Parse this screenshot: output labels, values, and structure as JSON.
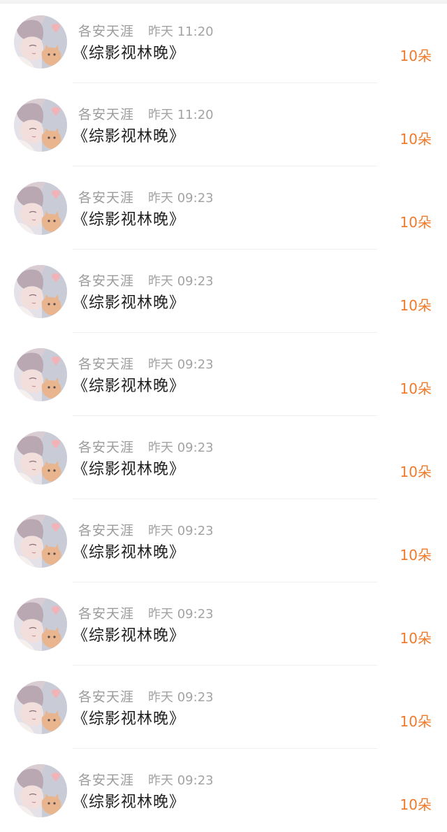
{
  "colors": {
    "amount": "#f07a2a",
    "name": "#9b9b9b",
    "title": "#1f1f1f"
  },
  "items": [
    {
      "user": "各安天涯",
      "time": "昨天 11:20",
      "book": "《综影视林晚》",
      "amount": "10朵",
      "avatar_icon": "avatar-girl-with-cat"
    },
    {
      "user": "各安天涯",
      "time": "昨天 11:20",
      "book": "《综影视林晚》",
      "amount": "10朵",
      "avatar_icon": "avatar-girl-with-cat"
    },
    {
      "user": "各安天涯",
      "time": "昨天 09:23",
      "book": "《综影视林晚》",
      "amount": "10朵",
      "avatar_icon": "avatar-girl-with-cat"
    },
    {
      "user": "各安天涯",
      "time": "昨天 09:23",
      "book": "《综影视林晚》",
      "amount": "10朵",
      "avatar_icon": "avatar-girl-with-cat"
    },
    {
      "user": "各安天涯",
      "time": "昨天 09:23",
      "book": "《综影视林晚》",
      "amount": "10朵",
      "avatar_icon": "avatar-girl-with-cat"
    },
    {
      "user": "各安天涯",
      "time": "昨天 09:23",
      "book": "《综影视林晚》",
      "amount": "10朵",
      "avatar_icon": "avatar-girl-with-cat"
    },
    {
      "user": "各安天涯",
      "time": "昨天 09:23",
      "book": "《综影视林晚》",
      "amount": "10朵",
      "avatar_icon": "avatar-girl-with-cat"
    },
    {
      "user": "各安天涯",
      "time": "昨天 09:23",
      "book": "《综影视林晚》",
      "amount": "10朵",
      "avatar_icon": "avatar-girl-with-cat"
    },
    {
      "user": "各安天涯",
      "time": "昨天 09:23",
      "book": "《综影视林晚》",
      "amount": "10朵",
      "avatar_icon": "avatar-girl-with-cat"
    },
    {
      "user": "各安天涯",
      "time": "昨天 09:23",
      "book": "《综影视林晚》",
      "amount": "10朵",
      "avatar_icon": "avatar-girl-with-cat"
    }
  ]
}
